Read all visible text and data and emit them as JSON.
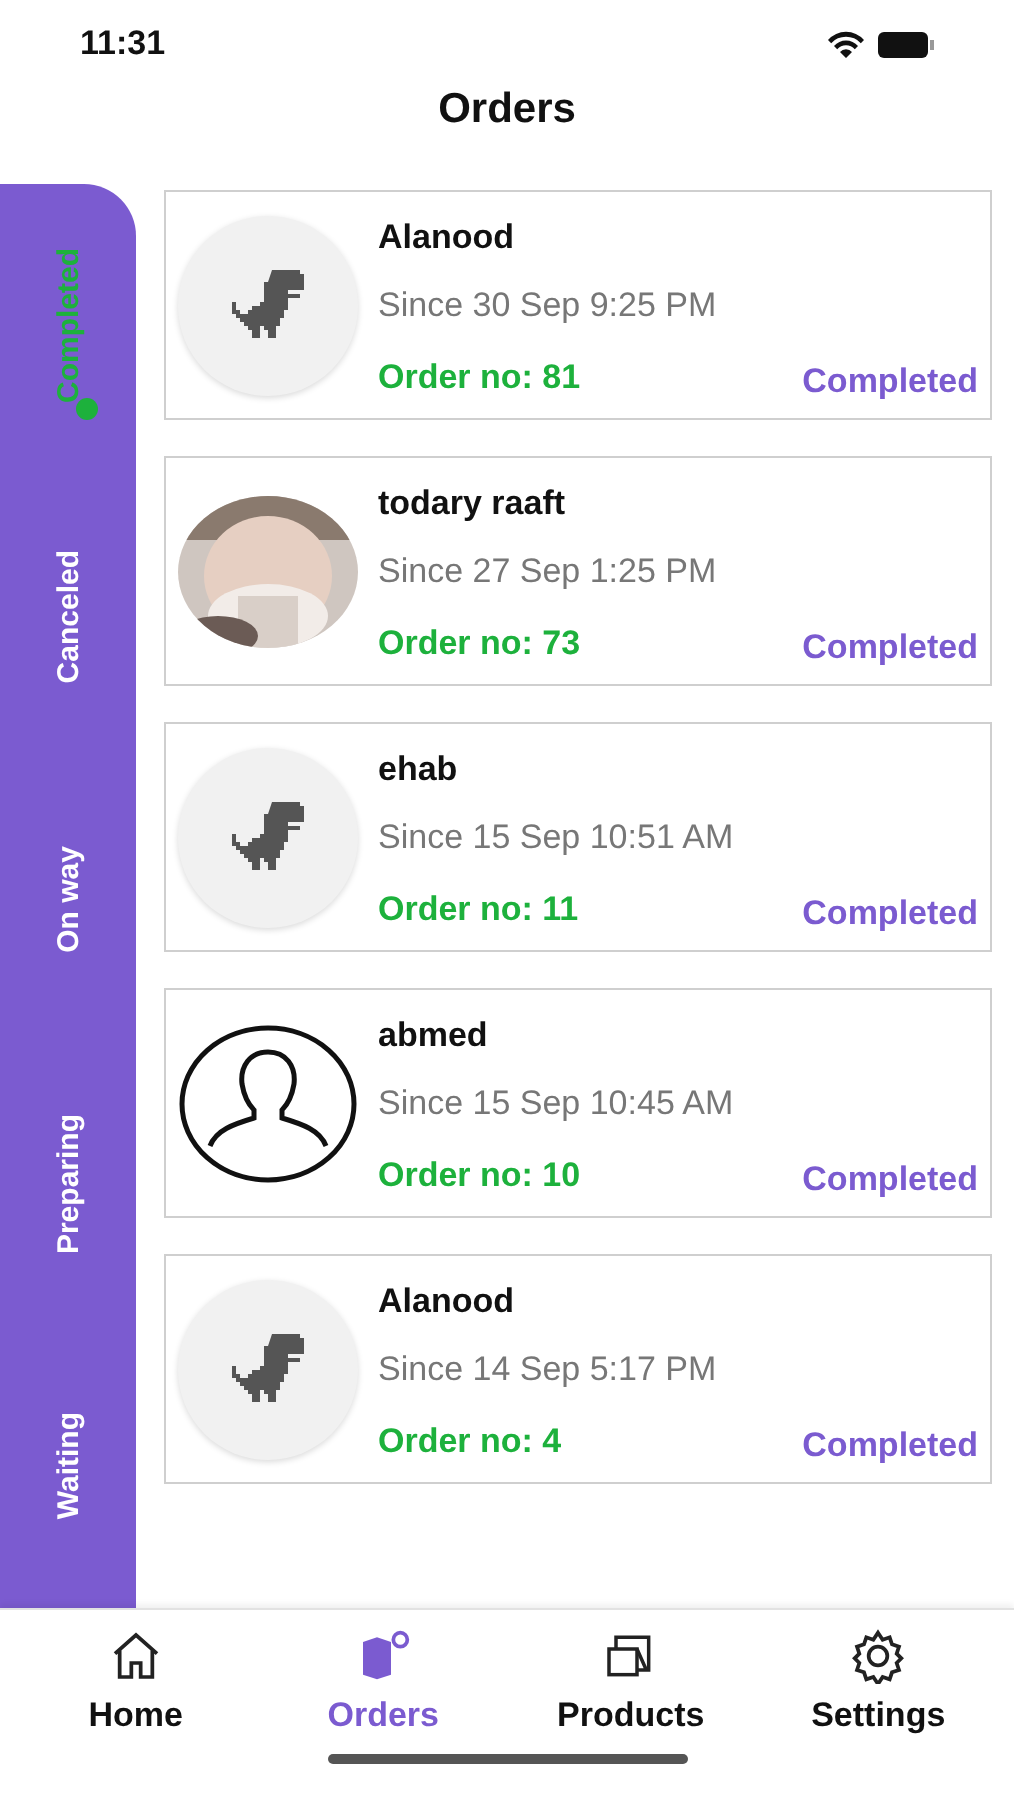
{
  "status_bar": {
    "time": "11:31"
  },
  "header": {
    "title": "Orders"
  },
  "status_tabs": [
    {
      "label": "Completed",
      "selected": true
    },
    {
      "label": "Canceled",
      "selected": false
    },
    {
      "label": "On way",
      "selected": false
    },
    {
      "label": "Preparing",
      "selected": false
    },
    {
      "label": "Waiting",
      "selected": false
    }
  ],
  "orders": [
    {
      "kind": "dino",
      "name": "Alanood",
      "since": "Since 30 Sep 9:25 PM",
      "order_no": "Order no: 81",
      "status": "Completed"
    },
    {
      "name": "todary raaft",
      "since": "Since 27 Sep 1:25 PM",
      "order_no": "Order no: 73",
      "status": "Completed"
    },
    {
      "kind": "dino",
      "name": "ehab",
      "since": "Since 15 Sep 10:51 AM",
      "order_no": "Order no: 11",
      "status": "Completed"
    },
    {
      "kind": "silhouette",
      "name": "abmed",
      "since": "Since 15 Sep 10:45 AM",
      "order_no": "Order no: 10",
      "status": "Completed"
    },
    {
      "kind": "dino",
      "name": "Alanood",
      "since": "Since 14 Sep 5:17 PM",
      "order_no": "Order no: 4",
      "status": "Completed"
    }
  ],
  "tab_bar": [
    {
      "kind": "home",
      "label": "Home",
      "selected": false
    },
    {
      "kind": "orders",
      "label": "Orders",
      "selected": true
    },
    {
      "kind": "products",
      "label": "Products",
      "selected": false
    },
    {
      "kind": "settings",
      "label": "Settings",
      "selected": false
    }
  ]
}
